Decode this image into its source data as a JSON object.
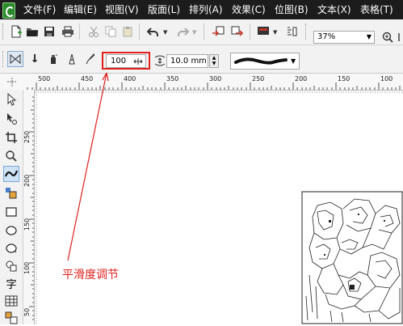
{
  "menu": {
    "items": [
      "文件(F)",
      "编辑(E)",
      "视图(V)",
      "版面(L)",
      "排列(A)",
      "效果(C)",
      "位图(B)",
      "文本(X)",
      "表格(T)"
    ]
  },
  "toolbar": {
    "zoom": "37%"
  },
  "property_bar": {
    "smoothing_value": "100",
    "nib_width": "10.0 mm"
  },
  "rulers": {
    "top_labels": [
      "500",
      "450",
      "400",
      "350",
      "300",
      "250",
      "200",
      "150",
      "100"
    ],
    "left_labels": [
      "250",
      "200",
      "150",
      "100",
      "50"
    ]
  },
  "toolbox": {
    "text_tool_glyph": "字"
  },
  "annotation": {
    "text": "平滑度调节"
  },
  "colors": {
    "accent": "#e0201c",
    "menubar": "#1c1c1c"
  }
}
